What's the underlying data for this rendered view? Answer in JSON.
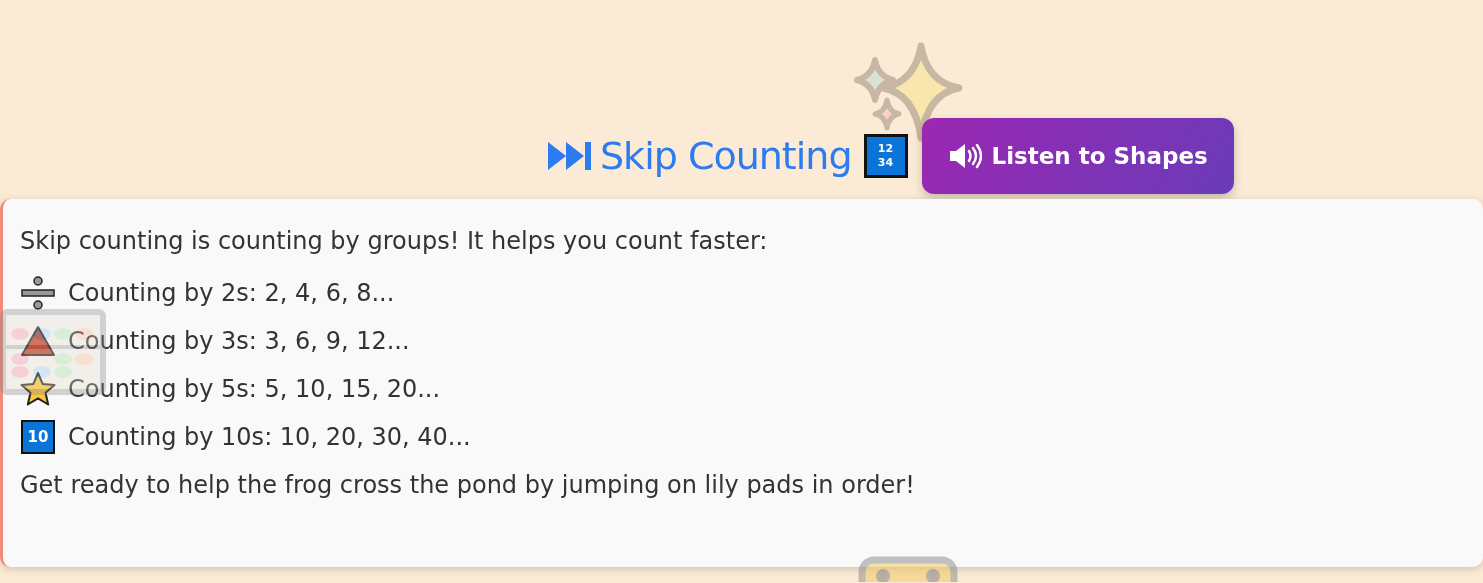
{
  "header": {
    "title": "Skip Counting",
    "badge_lines": [
      "12",
      "34"
    ],
    "listen_button": "Listen to Shapes"
  },
  "card": {
    "intro": "Skip counting is counting by groups! It helps you count faster:",
    "items": [
      {
        "kind": "divide",
        "text": "Counting by 2s: 2, 4, 6, 8..."
      },
      {
        "kind": "triangle",
        "text": "Counting by 3s: 3, 6, 9, 12..."
      },
      {
        "kind": "star",
        "text": "Counting by 5s: 5, 10, 15, 20..."
      },
      {
        "kind": "keycap",
        "badge": "10",
        "text": "Counting by 10s: 10, 20, 30, 40..."
      }
    ],
    "outro": "Get ready to help the frog cross the pond by jumping on lily pads in order!"
  }
}
